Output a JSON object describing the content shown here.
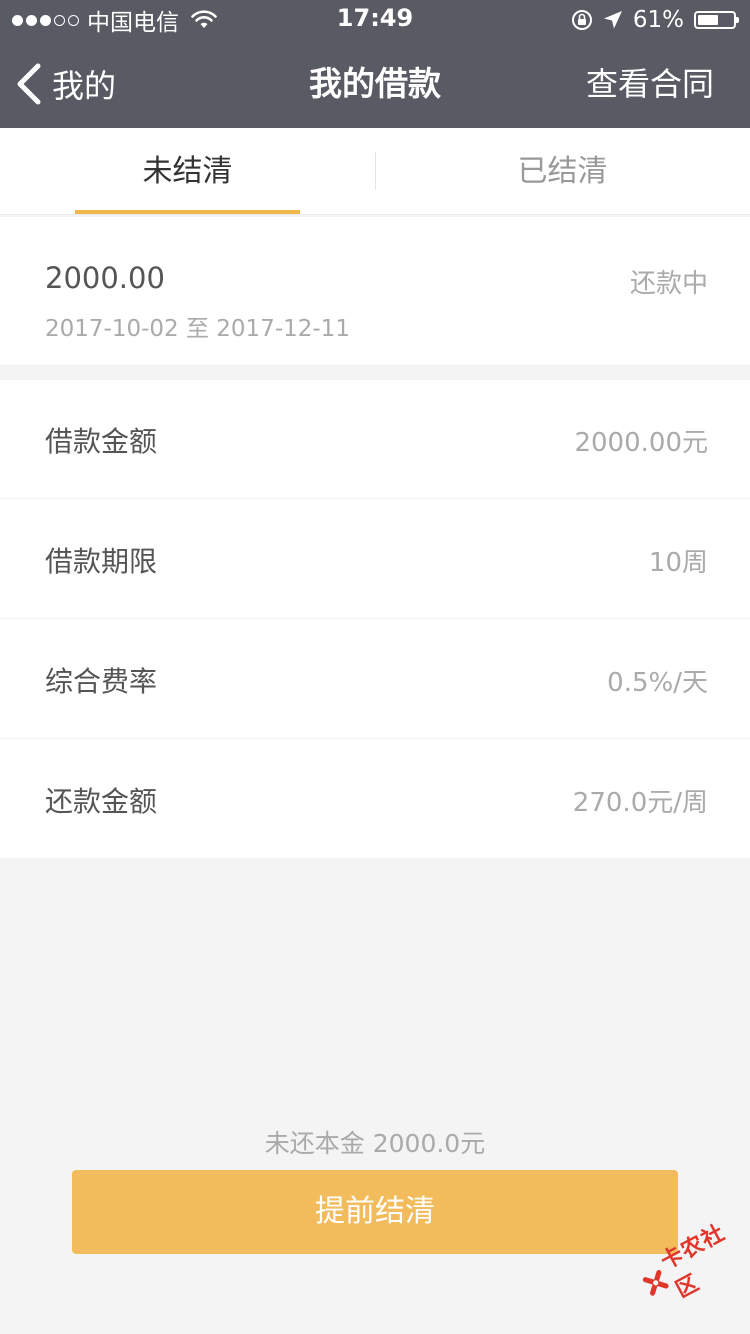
{
  "status_bar": {
    "carrier": "中国电信",
    "time": "17:49",
    "battery_percent": "61%",
    "battery_level": 0.61,
    "signal_bars_filled": 3,
    "signal_bars_total": 5
  },
  "nav": {
    "back_label": "我的",
    "title": "我的借款",
    "right_action": "查看合同"
  },
  "tabs": [
    {
      "label": "未结清",
      "active": true
    },
    {
      "label": "已结清",
      "active": false
    }
  ],
  "summary": {
    "amount": "2000.00",
    "date_range": "2017-10-02 至 2017-12-11",
    "status": "还款中"
  },
  "details": [
    {
      "label": "借款金额",
      "value": "2000.00元"
    },
    {
      "label": "借款期限",
      "value": "10周"
    },
    {
      "label": "综合费率",
      "value": "0.5%/天"
    },
    {
      "label": "还款金额",
      "value": "270.0元/周"
    }
  ],
  "footer": {
    "remaining_principal": "未还本金 2000.0元",
    "settle_button": "提前结清"
  },
  "watermark": {
    "text": "卡农社区"
  },
  "colors": {
    "header_bg": "#585b63",
    "accent": "#f0b84c",
    "button_bg": "#f2bc5c",
    "page_bg": "#f4f4f4"
  }
}
